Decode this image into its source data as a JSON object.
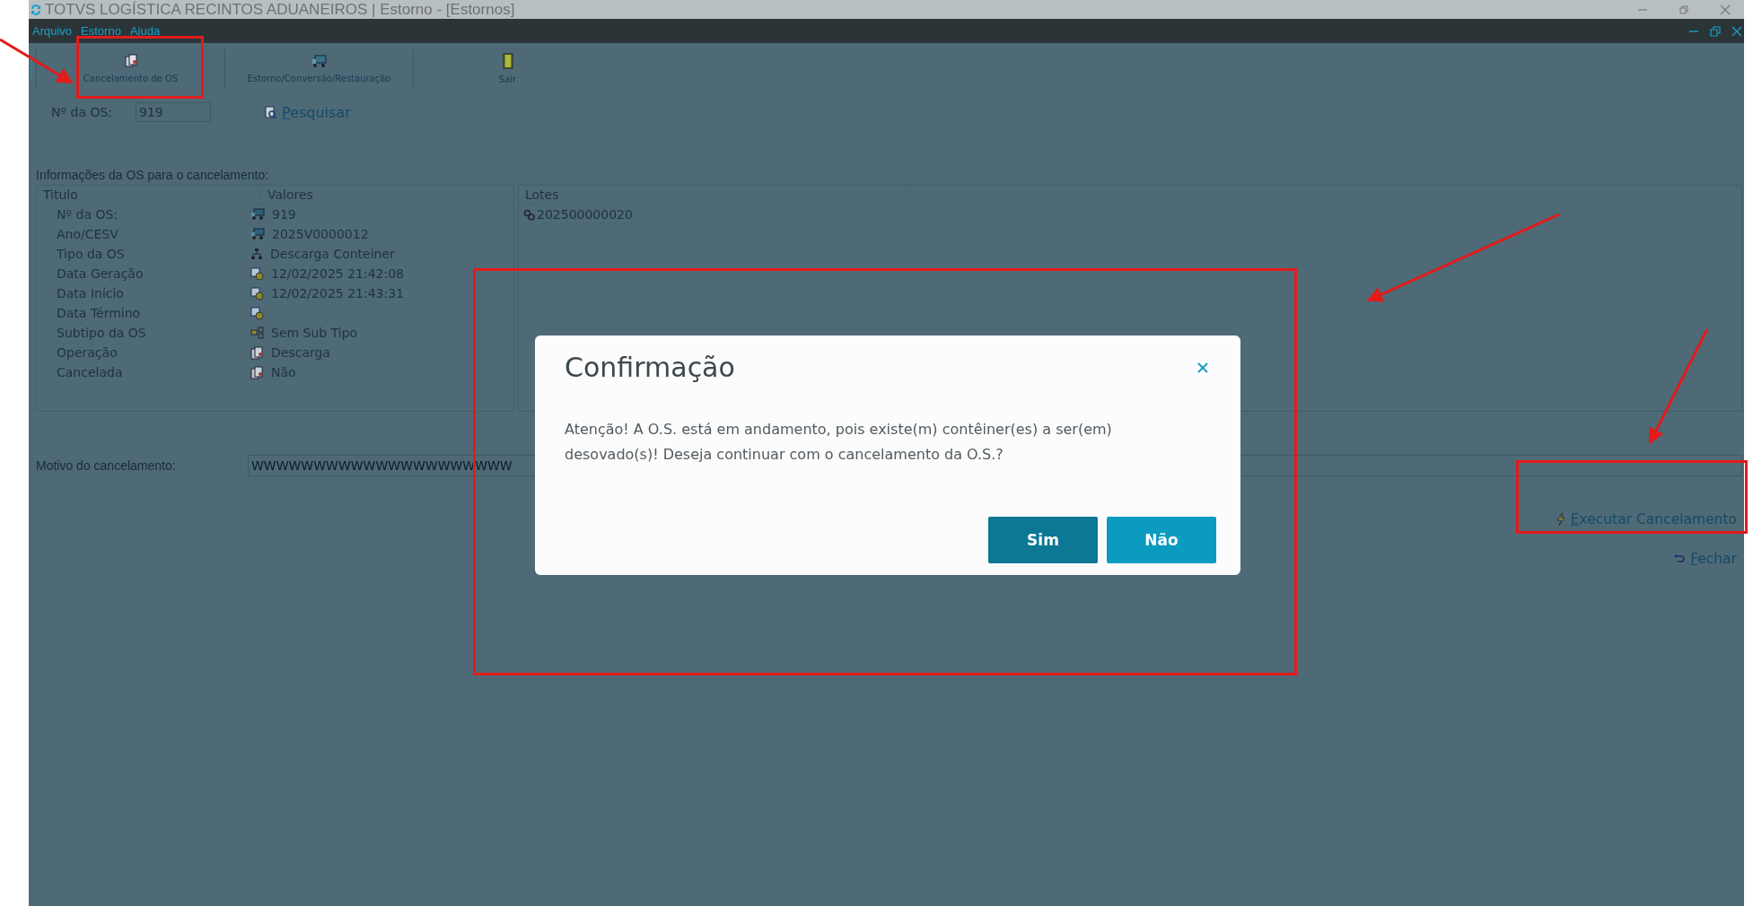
{
  "window": {
    "title": "TOTVS LOGÍSTICA RECINTOS ADUANEIROS | Estorno - [Estornos]"
  },
  "menu": [
    "Arquivo",
    "Estorno",
    "Ajuda"
  ],
  "toolbar": [
    {
      "label": "Cancelamento de OS",
      "kind": "cancel"
    },
    {
      "label": "Estorno/Conversão/Restauração",
      "kind": "reverse"
    },
    {
      "label": "Sair",
      "kind": "exit"
    }
  ],
  "search": {
    "label": "Nº da OS:",
    "value": "919",
    "button": "Pesquisar"
  },
  "info": {
    "title": "Informações da OS para o cancelamento:",
    "columns": [
      "Titulo",
      "Valores"
    ],
    "rows": [
      {
        "title": "Nº da OS:",
        "value": "919",
        "kind": "truck"
      },
      {
        "title": "Ano/CESV",
        "value": "2025V0000012",
        "kind": "truck"
      },
      {
        "title": "Tipo da OS",
        "value": "Descarga Conteiner",
        "kind": "tree"
      },
      {
        "title": "Data Geração",
        "value": "12/02/2025 21:42:08",
        "kind": "date"
      },
      {
        "title": "Data Início",
        "value": "12/02/2025 21:43:31",
        "kind": "date"
      },
      {
        "title": "Data Término",
        "value": "",
        "kind": "date"
      },
      {
        "title": "Subtipo da OS",
        "value": "Sem Sub Tipo",
        "kind": "subtype"
      },
      {
        "title": "Operação",
        "value": "Descarga",
        "kind": "ops"
      },
      {
        "title": "Cancelada",
        "value": "Não",
        "kind": "ops"
      }
    ]
  },
  "lots": {
    "column": "Lotes",
    "items": [
      "202500000020"
    ]
  },
  "reason": {
    "label": "Motivo do cancelamento:",
    "value": "WWWWWWWWWWWWWWWWWWWWW"
  },
  "actions": [
    {
      "label": "Executar Cancelamento",
      "kind": "run"
    },
    {
      "label": "Fechar",
      "kind": "close"
    }
  ],
  "dialog": {
    "title": "Confirmação",
    "message": "Atenção! A O.S. está em andamento, pois existe(m) contêiner(es) a ser(em) desovado(s)! Deseja continuar com o cancelamento da O.S.?",
    "buttons": [
      {
        "label": "Sim",
        "kind": "primary"
      },
      {
        "label": "Não",
        "kind": "secondary"
      }
    ]
  }
}
